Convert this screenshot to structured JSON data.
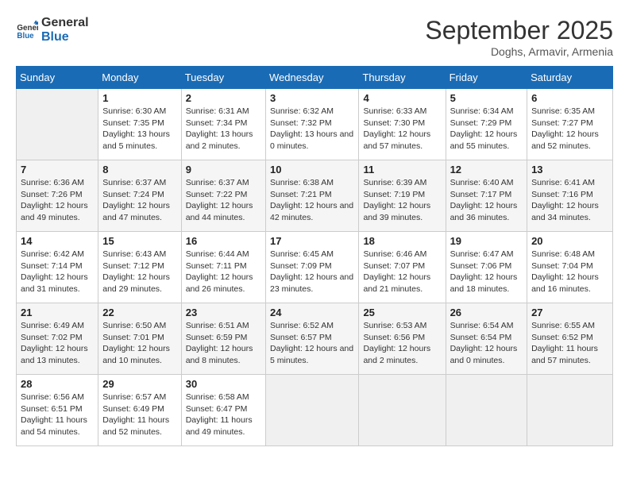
{
  "logo": {
    "text_general": "General",
    "text_blue": "Blue"
  },
  "title": "September 2025",
  "subtitle": "Doghs, Armavir, Armenia",
  "headers": [
    "Sunday",
    "Monday",
    "Tuesday",
    "Wednesday",
    "Thursday",
    "Friday",
    "Saturday"
  ],
  "weeks": [
    [
      {
        "day": "",
        "empty": true
      },
      {
        "day": "1",
        "sunrise": "Sunrise: 6:30 AM",
        "sunset": "Sunset: 7:35 PM",
        "daylight": "Daylight: 13 hours and 5 minutes."
      },
      {
        "day": "2",
        "sunrise": "Sunrise: 6:31 AM",
        "sunset": "Sunset: 7:34 PM",
        "daylight": "Daylight: 13 hours and 2 minutes."
      },
      {
        "day": "3",
        "sunrise": "Sunrise: 6:32 AM",
        "sunset": "Sunset: 7:32 PM",
        "daylight": "Daylight: 13 hours and 0 minutes."
      },
      {
        "day": "4",
        "sunrise": "Sunrise: 6:33 AM",
        "sunset": "Sunset: 7:30 PM",
        "daylight": "Daylight: 12 hours and 57 minutes."
      },
      {
        "day": "5",
        "sunrise": "Sunrise: 6:34 AM",
        "sunset": "Sunset: 7:29 PM",
        "daylight": "Daylight: 12 hours and 55 minutes."
      },
      {
        "day": "6",
        "sunrise": "Sunrise: 6:35 AM",
        "sunset": "Sunset: 7:27 PM",
        "daylight": "Daylight: 12 hours and 52 minutes."
      }
    ],
    [
      {
        "day": "7",
        "sunrise": "Sunrise: 6:36 AM",
        "sunset": "Sunset: 7:26 PM",
        "daylight": "Daylight: 12 hours and 49 minutes."
      },
      {
        "day": "8",
        "sunrise": "Sunrise: 6:37 AM",
        "sunset": "Sunset: 7:24 PM",
        "daylight": "Daylight: 12 hours and 47 minutes."
      },
      {
        "day": "9",
        "sunrise": "Sunrise: 6:37 AM",
        "sunset": "Sunset: 7:22 PM",
        "daylight": "Daylight: 12 hours and 44 minutes."
      },
      {
        "day": "10",
        "sunrise": "Sunrise: 6:38 AM",
        "sunset": "Sunset: 7:21 PM",
        "daylight": "Daylight: 12 hours and 42 minutes."
      },
      {
        "day": "11",
        "sunrise": "Sunrise: 6:39 AM",
        "sunset": "Sunset: 7:19 PM",
        "daylight": "Daylight: 12 hours and 39 minutes."
      },
      {
        "day": "12",
        "sunrise": "Sunrise: 6:40 AM",
        "sunset": "Sunset: 7:17 PM",
        "daylight": "Daylight: 12 hours and 36 minutes."
      },
      {
        "day": "13",
        "sunrise": "Sunrise: 6:41 AM",
        "sunset": "Sunset: 7:16 PM",
        "daylight": "Daylight: 12 hours and 34 minutes."
      }
    ],
    [
      {
        "day": "14",
        "sunrise": "Sunrise: 6:42 AM",
        "sunset": "Sunset: 7:14 PM",
        "daylight": "Daylight: 12 hours and 31 minutes."
      },
      {
        "day": "15",
        "sunrise": "Sunrise: 6:43 AM",
        "sunset": "Sunset: 7:12 PM",
        "daylight": "Daylight: 12 hours and 29 minutes."
      },
      {
        "day": "16",
        "sunrise": "Sunrise: 6:44 AM",
        "sunset": "Sunset: 7:11 PM",
        "daylight": "Daylight: 12 hours and 26 minutes."
      },
      {
        "day": "17",
        "sunrise": "Sunrise: 6:45 AM",
        "sunset": "Sunset: 7:09 PM",
        "daylight": "Daylight: 12 hours and 23 minutes."
      },
      {
        "day": "18",
        "sunrise": "Sunrise: 6:46 AM",
        "sunset": "Sunset: 7:07 PM",
        "daylight": "Daylight: 12 hours and 21 minutes."
      },
      {
        "day": "19",
        "sunrise": "Sunrise: 6:47 AM",
        "sunset": "Sunset: 7:06 PM",
        "daylight": "Daylight: 12 hours and 18 minutes."
      },
      {
        "day": "20",
        "sunrise": "Sunrise: 6:48 AM",
        "sunset": "Sunset: 7:04 PM",
        "daylight": "Daylight: 12 hours and 16 minutes."
      }
    ],
    [
      {
        "day": "21",
        "sunrise": "Sunrise: 6:49 AM",
        "sunset": "Sunset: 7:02 PM",
        "daylight": "Daylight: 12 hours and 13 minutes."
      },
      {
        "day": "22",
        "sunrise": "Sunrise: 6:50 AM",
        "sunset": "Sunset: 7:01 PM",
        "daylight": "Daylight: 12 hours and 10 minutes."
      },
      {
        "day": "23",
        "sunrise": "Sunrise: 6:51 AM",
        "sunset": "Sunset: 6:59 PM",
        "daylight": "Daylight: 12 hours and 8 minutes."
      },
      {
        "day": "24",
        "sunrise": "Sunrise: 6:52 AM",
        "sunset": "Sunset: 6:57 PM",
        "daylight": "Daylight: 12 hours and 5 minutes."
      },
      {
        "day": "25",
        "sunrise": "Sunrise: 6:53 AM",
        "sunset": "Sunset: 6:56 PM",
        "daylight": "Daylight: 12 hours and 2 minutes."
      },
      {
        "day": "26",
        "sunrise": "Sunrise: 6:54 AM",
        "sunset": "Sunset: 6:54 PM",
        "daylight": "Daylight: 12 hours and 0 minutes."
      },
      {
        "day": "27",
        "sunrise": "Sunrise: 6:55 AM",
        "sunset": "Sunset: 6:52 PM",
        "daylight": "Daylight: 11 hours and 57 minutes."
      }
    ],
    [
      {
        "day": "28",
        "sunrise": "Sunrise: 6:56 AM",
        "sunset": "Sunset: 6:51 PM",
        "daylight": "Daylight: 11 hours and 54 minutes."
      },
      {
        "day": "29",
        "sunrise": "Sunrise: 6:57 AM",
        "sunset": "Sunset: 6:49 PM",
        "daylight": "Daylight: 11 hours and 52 minutes."
      },
      {
        "day": "30",
        "sunrise": "Sunrise: 6:58 AM",
        "sunset": "Sunset: 6:47 PM",
        "daylight": "Daylight: 11 hours and 49 minutes."
      },
      {
        "day": "",
        "empty": true
      },
      {
        "day": "",
        "empty": true
      },
      {
        "day": "",
        "empty": true
      },
      {
        "day": "",
        "empty": true
      }
    ]
  ]
}
